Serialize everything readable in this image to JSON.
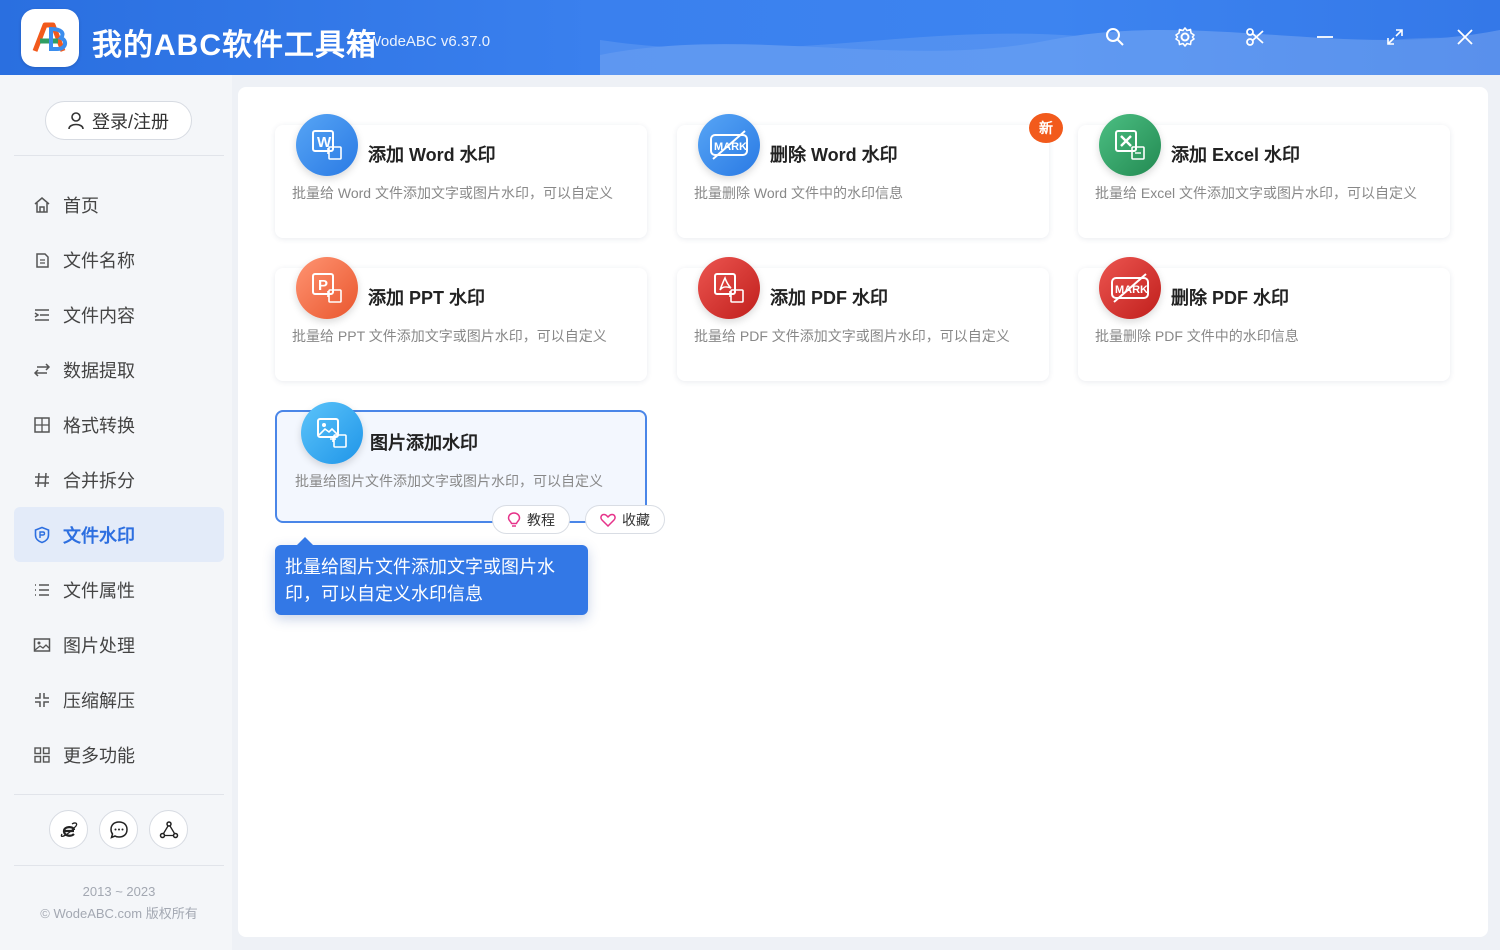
{
  "app": {
    "title": "我的ABC软件工具箱",
    "version": "WodeABC v6.37.0",
    "logo_text": "AB"
  },
  "titlebar_buttons": [
    "search-icon",
    "gear-icon",
    "scissors-icon",
    "minimize-icon",
    "maximize-icon",
    "close-icon"
  ],
  "sidebar": {
    "login_label": "登录/注册",
    "items": [
      {
        "label": "首页",
        "icon": "home-icon"
      },
      {
        "label": "文件名称",
        "icon": "file-name-icon"
      },
      {
        "label": "文件内容",
        "icon": "file-content-icon"
      },
      {
        "label": "数据提取",
        "icon": "data-extract-icon"
      },
      {
        "label": "格式转换",
        "icon": "format-convert-icon"
      },
      {
        "label": "合并拆分",
        "icon": "merge-split-icon"
      },
      {
        "label": "文件水印",
        "icon": "watermark-icon",
        "active": true
      },
      {
        "label": "文件属性",
        "icon": "file-properties-icon"
      },
      {
        "label": "图片处理",
        "icon": "image-icon"
      },
      {
        "label": "压缩解压",
        "icon": "compress-icon"
      },
      {
        "label": "更多功能",
        "icon": "more-icon"
      }
    ],
    "bottom_buttons": [
      "browser-icon",
      "chat-icon",
      "share-icon"
    ],
    "copyright_years": "2013 ~ 2023",
    "copyright_text": "© WodeABC.com 版权所有"
  },
  "cards": [
    {
      "title": "添加 Word 水印",
      "desc": "批量给 Word 文件添加文字或图片水印，可以自定义",
      "icon": "word-add-icon",
      "color": "#3b8ded"
    },
    {
      "title": "删除 Word 水印",
      "desc": "批量删除 Word 文件中的水印信息",
      "icon": "word-remove-watermark-icon",
      "color": "#3b8ded",
      "badge": "新"
    },
    {
      "title": "添加 Excel 水印",
      "desc": "批量给 Excel 文件添加文字或图片水印，可以自定义",
      "icon": "excel-add-icon",
      "color": "#2f9e63"
    },
    {
      "title": "添加 PPT 水印",
      "desc": "批量给 PPT 文件添加文字或图片水印，可以自定义",
      "icon": "ppt-add-icon",
      "color": "#f07048"
    },
    {
      "title": "添加 PDF 水印",
      "desc": "批量给 PDF 文件添加文字或图片水印，可以自定义",
      "icon": "pdf-add-icon",
      "color": "#d9322e"
    },
    {
      "title": "删除 PDF 水印",
      "desc": "批量删除 PDF 文件中的水印信息",
      "icon": "pdf-remove-watermark-icon",
      "color": "#d9322e"
    },
    {
      "title": "图片添加水印",
      "desc": "批量给图片文件添加文字或图片水印，可以自定义",
      "icon": "image-add-icon",
      "color": "#35a8f0",
      "highlighted": true
    }
  ],
  "card_actions": {
    "tutorial": "教程",
    "favorite": "收藏"
  },
  "tooltip": {
    "line1": "批量给图片文件添加文字或图片水",
    "line2": "印，可以自定义水印信息"
  },
  "colors": {
    "titlebar": "#3478e8",
    "accent": "#2d6fe0",
    "badge": "#f25a1c"
  }
}
